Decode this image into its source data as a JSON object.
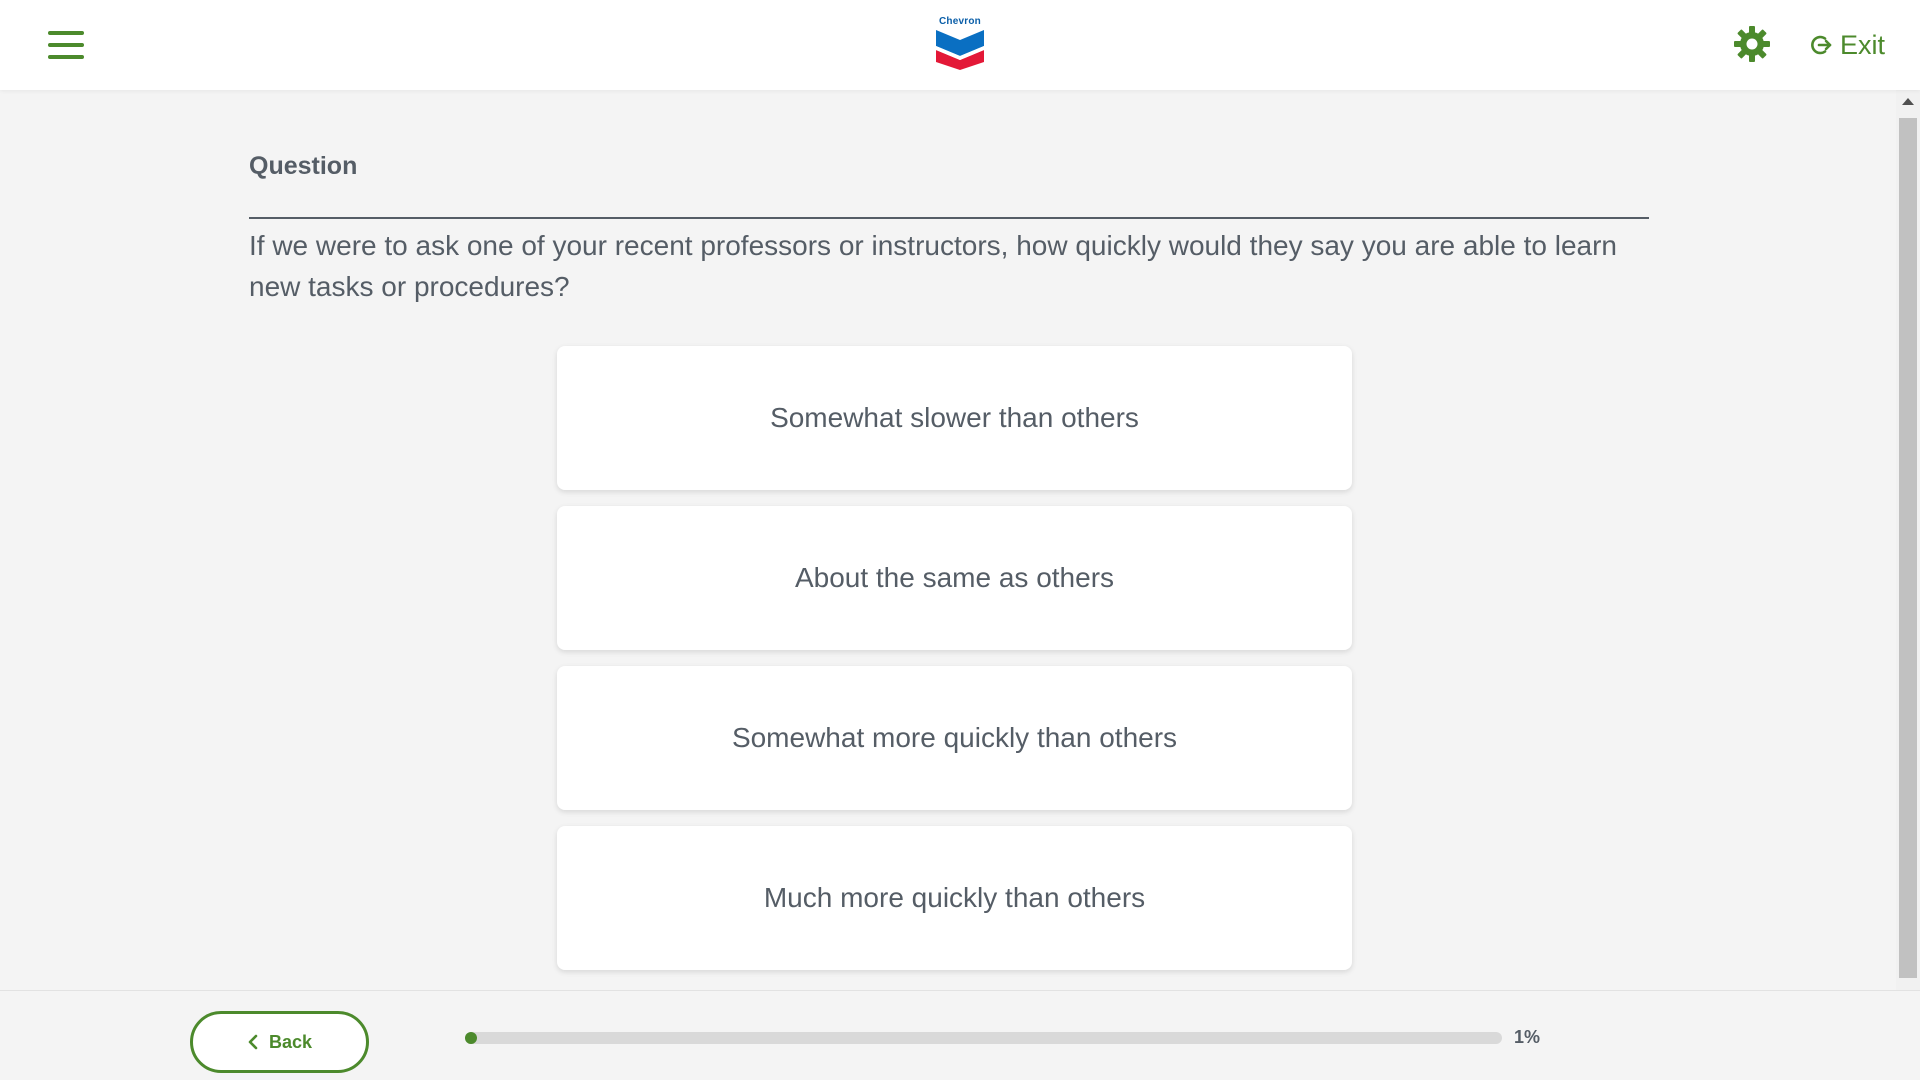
{
  "header": {
    "logo_text": "Chevron",
    "exit_label": "Exit",
    "icons": {
      "menu": "hamburger-menu-icon",
      "settings": "gear-icon",
      "exit": "exit-icon"
    },
    "accent_color": "#4c8a2c"
  },
  "question": {
    "label": "Question",
    "text": "If we were to ask one of your recent professors or instructors, how quickly would they say you are able to learn new tasks or procedures?"
  },
  "options": [
    {
      "label": "Somewhat slower than others"
    },
    {
      "label": "About the same as others"
    },
    {
      "label": "Somewhat more quickly than others"
    },
    {
      "label": "Much more quickly than others"
    }
  ],
  "footer": {
    "back_label": "Back",
    "progress_percent": 1,
    "progress_text": "1%"
  }
}
